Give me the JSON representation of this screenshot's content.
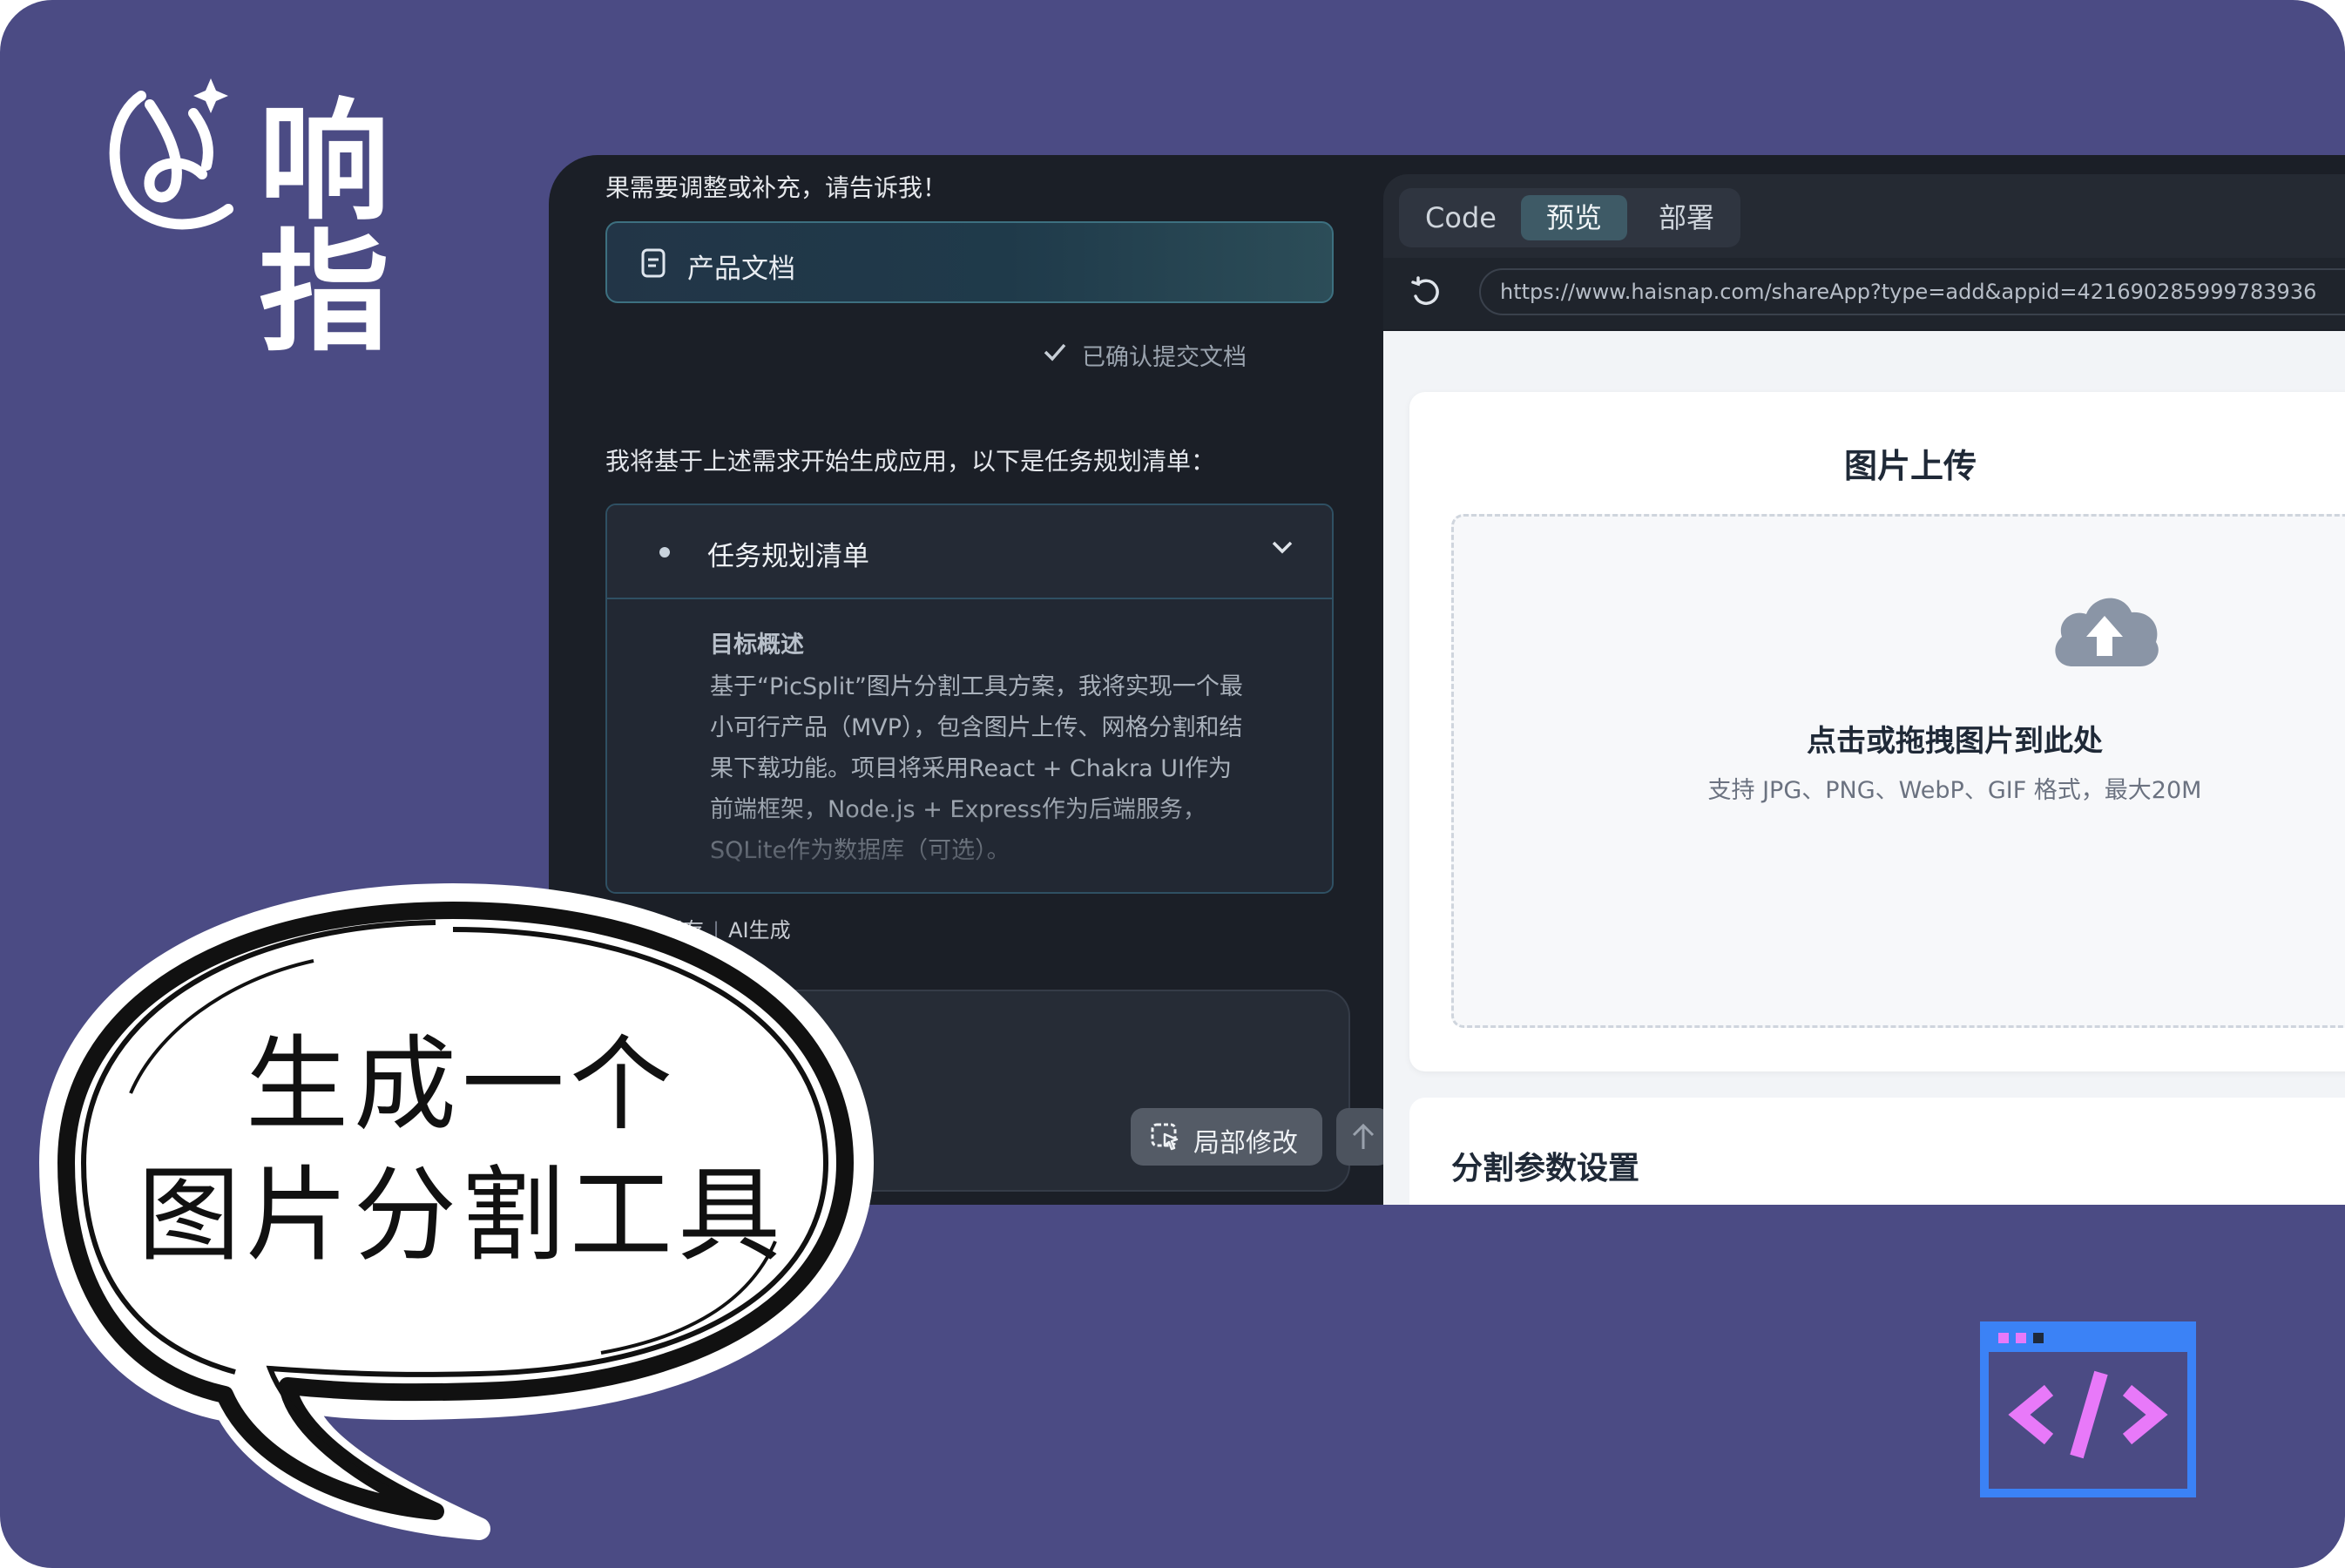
{
  "brand": {
    "name": "响指"
  },
  "chat": {
    "top_message": "果需要调整或补充，请告诉我！",
    "doc_card_label": "产品文档",
    "confirm_text": "已确认提交文档",
    "plan_intro": "我将基于上述需求开始生成应用，以下是任务规划清单：",
    "plan": {
      "title": "任务规划清单",
      "subtitle": "目标概述",
      "body": "基于“PicSplit”图片分割工具方案，我将实现一个最小可行产品（MVP），包含图片上传、网格分割和结果下载功能。项目将采用React + Chakra UI作为前端框架，Node.js + Express作为后端服务，SQLite作为数据库（可选）。"
    },
    "saved_text": "保存",
    "ai_text": "AI生成",
    "local_edit_button": "局部修改"
  },
  "preview": {
    "tabs": [
      {
        "label": "Code",
        "active": false
      },
      {
        "label": "预览",
        "active": true
      },
      {
        "label": "部署",
        "active": false
      }
    ],
    "url": "https://www.haisnap.com/shareApp?type=add&appid=421690285999783936",
    "upload_title": "图片上传",
    "drop_main": "点击或拖拽图片到此处",
    "drop_sub": "支持 JPG、PNG、WebP、GIF 格式，最大20M",
    "split_title": "分割参数设置"
  },
  "bubble": {
    "line1": "生成一个",
    "line2": "图片分割工具"
  },
  "colors": {
    "background": "#4b4b84",
    "app_dark": "#1b1f27",
    "accent_teal": "#3e5a66",
    "code_icon_blue": "#3b82f6",
    "code_icon_pink": "#e879f9"
  }
}
